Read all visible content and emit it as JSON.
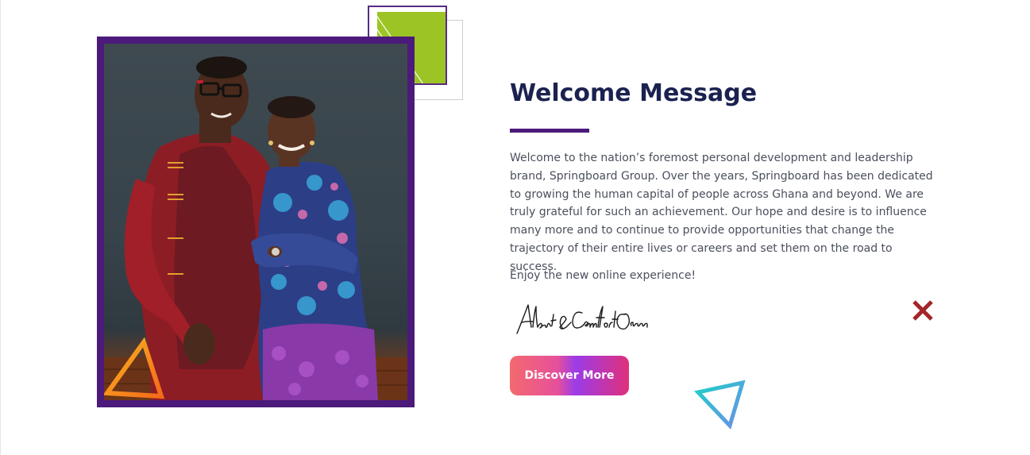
{
  "welcome": {
    "title": "Welcome Message",
    "paragraph": "Welcome to the nation’s foremost personal development and leadership brand, Springboard Group. Over the years, Springboard has been dedicated to growing the human capital of people across Ghana and beyond. We are truly grateful for such an achievement. Our hope and desire is to influence many more and to continue to provide opportunities that change the trajectory of their entire lives or careers and set them on the road to success.",
    "closing": "Enjoy the new online experience!",
    "signature": "Albert & Comfort Ocran",
    "button_label": "Discover More"
  },
  "icons": {
    "photo": "couple-photo",
    "signature": "handwritten-signature-image",
    "close": "close-x-icon",
    "triangle_orange": "orange-triangle-decoration",
    "triangle_teal": "teal-triangle-decoration",
    "square": "green-square-decoration"
  },
  "colors": {
    "title": "#1b2250",
    "accent_purple": "#4b1a7a",
    "green": "#9cc424",
    "close_red": "#a32528",
    "button_gradient_start": "#f36a6e",
    "button_gradient_end": "#e0307a",
    "triangle_teal": "#1fd0c8",
    "triangle_orange": "#f7941d"
  }
}
